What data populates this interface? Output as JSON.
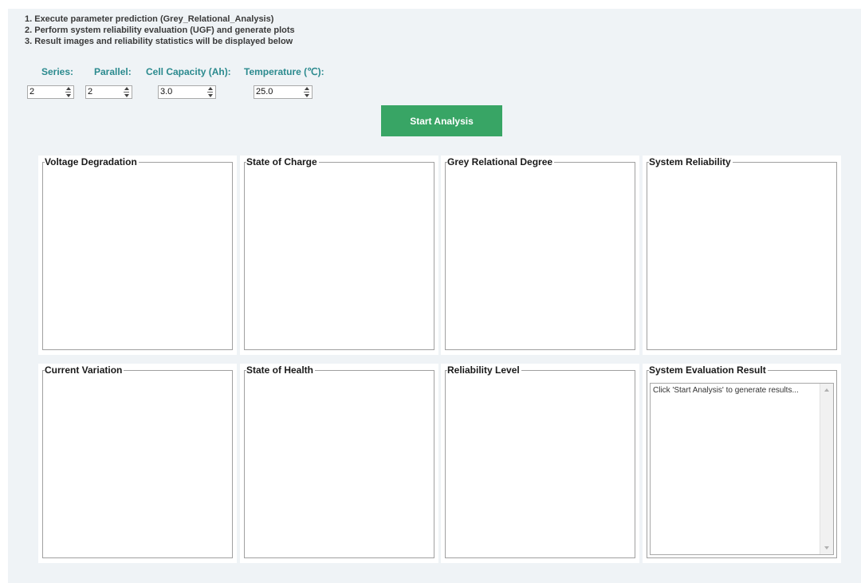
{
  "instructions": [
    "1. Execute parameter prediction (Grey_Relational_Analysis)",
    "2. Perform system reliability evaluation (UGF) and generate plots",
    "3. Result images and reliability statistics will be displayed below"
  ],
  "params": {
    "series": {
      "label": "Series:",
      "value": "2"
    },
    "parallel": {
      "label": "Parallel:",
      "value": "2"
    },
    "capacity": {
      "label": "Cell Capacity (Ah):",
      "value": "3.0"
    },
    "temperature": {
      "label": "Temperature (℃):",
      "value": "25.0"
    }
  },
  "start_button": "Start Analysis",
  "panels": {
    "voltage": "Voltage Degradation",
    "soc": "State of Charge",
    "grey": "Grey Relational Degree",
    "system_reliability": "System Reliability",
    "current": "Current Variation",
    "soh": "State of Health",
    "reliability_level": "Reliability Level",
    "evaluation": "System Evaluation Result"
  },
  "evaluation_text": "Click 'Start Analysis' to generate results..."
}
